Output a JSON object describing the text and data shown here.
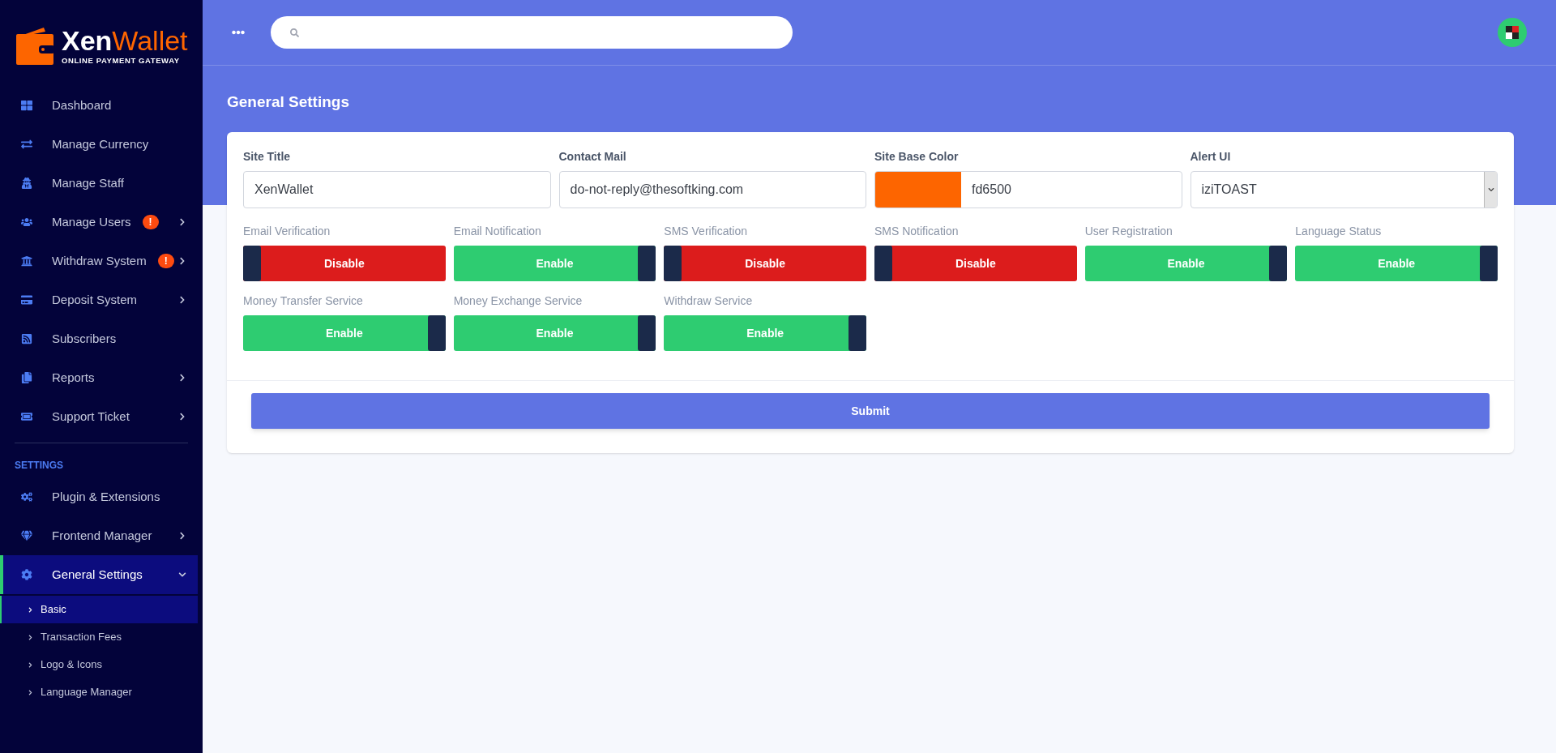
{
  "logo": {
    "name_first": "Xen",
    "name_second": "Wallet",
    "tagline": "ONLINE PAYMENT GATEWAY"
  },
  "sidebar": {
    "items": [
      {
        "label": "Dashboard",
        "has_submenu": false,
        "selected": false
      },
      {
        "label": "Manage Currency",
        "has_submenu": false,
        "selected": false
      },
      {
        "label": "Manage Staff",
        "has_submenu": false,
        "selected": false
      },
      {
        "label": "Manage Users",
        "badge": "!",
        "has_submenu": true,
        "selected": false
      },
      {
        "label": "Withdraw System",
        "badge": "!",
        "has_submenu": true,
        "selected": false
      },
      {
        "label": "Deposit System",
        "has_submenu": true,
        "selected": false
      },
      {
        "label": "Subscribers",
        "has_submenu": false,
        "selected": false
      },
      {
        "label": "Reports",
        "has_submenu": true,
        "selected": false
      },
      {
        "label": "Support Ticket",
        "has_submenu": true,
        "selected": false
      }
    ],
    "section_title": "SETTINGS",
    "settings_items": [
      {
        "label": "Plugin & Extensions",
        "has_submenu": false,
        "selected": false
      },
      {
        "label": "Frontend Manager",
        "has_submenu": true,
        "selected": false
      },
      {
        "label": "General Settings",
        "has_submenu": true,
        "selected": true,
        "expanded": true,
        "children": [
          {
            "label": "Basic",
            "selected": true
          },
          {
            "label": "Transaction Fees",
            "selected": false
          },
          {
            "label": "Logo & Icons",
            "selected": false
          },
          {
            "label": "Language Manager",
            "selected": false
          }
        ]
      }
    ]
  },
  "page_title": "General Settings",
  "fields": [
    {
      "kind": "text",
      "label": "Site Title",
      "value": "XenWallet"
    },
    {
      "kind": "text",
      "label": "Contact Mail",
      "value": "do-not-reply@thesoftking.com"
    },
    {
      "kind": "color",
      "label": "Site Base Color",
      "value": "fd6500",
      "color": "#fd6500"
    },
    {
      "kind": "select",
      "label": "Alert UI",
      "value": "iziTOAST"
    }
  ],
  "toggles": [
    {
      "label": "Email Verification",
      "on": false,
      "text": "Disable"
    },
    {
      "label": "Email Notification",
      "on": true,
      "text": "Enable"
    },
    {
      "label": "SMS Verification",
      "on": false,
      "text": "Disable"
    },
    {
      "label": "SMS Notification",
      "on": false,
      "text": "Disable"
    },
    {
      "label": "User Registration",
      "on": true,
      "text": "Enable"
    },
    {
      "label": "Language Status",
      "on": true,
      "text": "Enable"
    },
    {
      "label": "Money Transfer Service",
      "on": true,
      "text": "Enable"
    },
    {
      "label": "Money Exchange Service",
      "on": true,
      "text": "Enable"
    },
    {
      "label": "Withdraw Service",
      "on": true,
      "text": "Enable"
    }
  ],
  "submit": "Submit"
}
